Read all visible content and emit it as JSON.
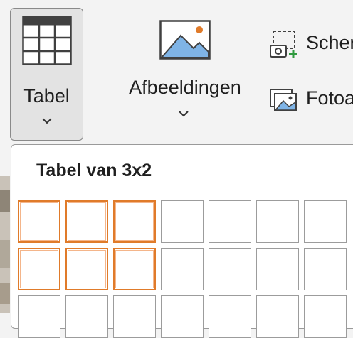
{
  "ribbon": {
    "table_button": {
      "label": "Tabel",
      "icon": "table-grid-icon"
    },
    "images_button": {
      "label": "Afbeeldingen",
      "icon": "picture-icon"
    },
    "screenshot_button": {
      "label": "Scher",
      "icon": "screenshot-icon"
    },
    "photo_album_button": {
      "label": "Fotoa",
      "icon": "photo-album-icon"
    }
  },
  "table_dropdown": {
    "title": "Tabel van 3x2",
    "columns": 7,
    "visible_rows": 3,
    "selected": {
      "columns": 3,
      "rows": 2
    },
    "highlight_color": "#e07b2a"
  },
  "colors": {
    "ribbon_bg": "#f3f3f3",
    "picture_blue": "#7fb4e6",
    "picture_sun": "#e07b2a",
    "add_green": "#2f9a3f"
  }
}
